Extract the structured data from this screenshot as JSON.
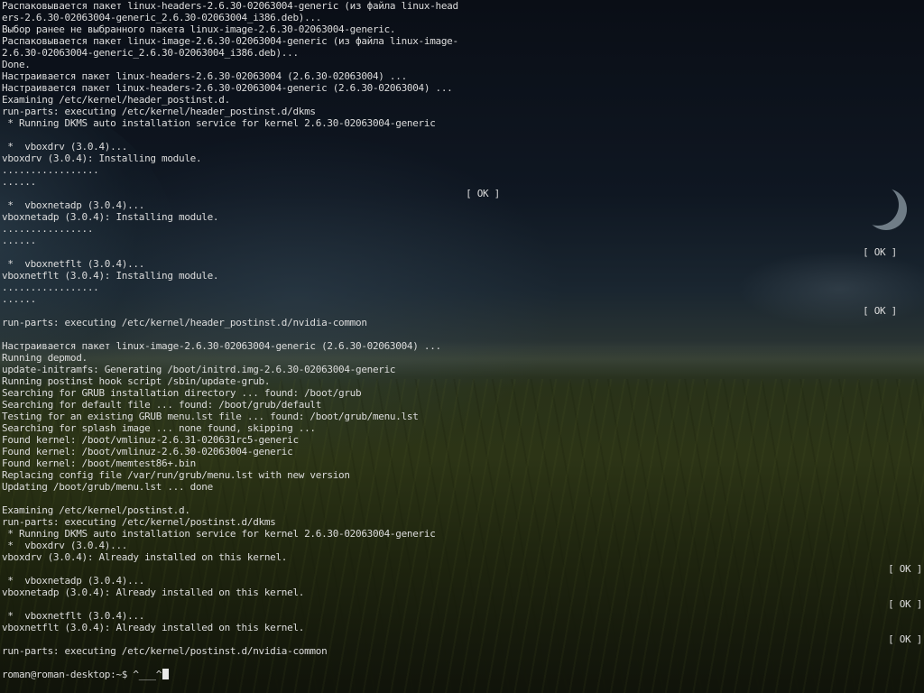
{
  "terminal": {
    "lines": [
      {
        "text": "Распаковывается пакет linux-headers-2.6.30-02063004-generic (из файла linux-head"
      },
      {
        "text": "ers-2.6.30-02063004-generic_2.6.30-02063004_i386.deb)..."
      },
      {
        "text": "Выбор ранее не выбранного пакета linux-image-2.6.30-02063004-generic."
      },
      {
        "text": "Распаковывается пакет linux-image-2.6.30-02063004-generic (из файла linux-image-"
      },
      {
        "text": "2.6.30-02063004-generic_2.6.30-02063004_i386.deb)..."
      },
      {
        "text": "Done."
      },
      {
        "text": "Настраивается пакет linux-headers-2.6.30-02063004 (2.6.30-02063004) ..."
      },
      {
        "text": "Настраивается пакет linux-headers-2.6.30-02063004-generic (2.6.30-02063004) ..."
      },
      {
        "text": "Examining /etc/kernel/header_postinst.d."
      },
      {
        "text": "run-parts: executing /etc/kernel/header_postinst.d/dkms"
      },
      {
        "text": " * Running DKMS auto installation service for kernel 2.6.30-02063004-generic"
      },
      {
        "text": ""
      },
      {
        "text": " *  vboxdrv (3.0.4)..."
      },
      {
        "text": "vboxdrv (3.0.4): Installing module."
      },
      {
        "text": "................."
      },
      {
        "text": "......"
      },
      {
        "text": "",
        "ok": "[ OK ]",
        "ok_pos": "mid"
      },
      {
        "text": " *  vboxnetadp (3.0.4)..."
      },
      {
        "text": "vboxnetadp (3.0.4): Installing module."
      },
      {
        "text": "................"
      },
      {
        "text": "......"
      },
      {
        "text": "",
        "ok": "[ OK ]",
        "ok_pos": "right"
      },
      {
        "text": " *  vboxnetflt (3.0.4)..."
      },
      {
        "text": "vboxnetflt (3.0.4): Installing module."
      },
      {
        "text": "................."
      },
      {
        "text": "......"
      },
      {
        "text": "",
        "ok": "[ OK ]",
        "ok_pos": "right"
      },
      {
        "text": "run-parts: executing /etc/kernel/header_postinst.d/nvidia-common"
      },
      {
        "text": ""
      },
      {
        "text": "Настраивается пакет linux-image-2.6.30-02063004-generic (2.6.30-02063004) ..."
      },
      {
        "text": "Running depmod."
      },
      {
        "text": "update-initramfs: Generating /boot/initrd.img-2.6.30-02063004-generic"
      },
      {
        "text": "Running postinst hook script /sbin/update-grub."
      },
      {
        "text": "Searching for GRUB installation directory ... found: /boot/grub"
      },
      {
        "text": "Searching for default file ... found: /boot/grub/default"
      },
      {
        "text": "Testing for an existing GRUB menu.lst file ... found: /boot/grub/menu.lst"
      },
      {
        "text": "Searching for splash image ... none found, skipping ..."
      },
      {
        "text": "Found kernel: /boot/vmlinuz-2.6.31-020631rc5-generic"
      },
      {
        "text": "Found kernel: /boot/vmlinuz-2.6.30-02063004-generic"
      },
      {
        "text": "Found kernel: /boot/memtest86+.bin"
      },
      {
        "text": "Replacing config file /var/run/grub/menu.lst with new version"
      },
      {
        "text": "Updating /boot/grub/menu.lst ... done"
      },
      {
        "text": ""
      },
      {
        "text": "Examining /etc/kernel/postinst.d."
      },
      {
        "text": "run-parts: executing /etc/kernel/postinst.d/dkms"
      },
      {
        "text": " * Running DKMS auto installation service for kernel 2.6.30-02063004-generic"
      },
      {
        "text": " *  vboxdrv (3.0.4)..."
      },
      {
        "text": "vboxdrv (3.0.4): Already installed on this kernel."
      },
      {
        "text": "",
        "ok": "[ OK ]",
        "ok_pos": "edge"
      },
      {
        "text": " *  vboxnetadp (3.0.4)..."
      },
      {
        "text": "vboxnetadp (3.0.4): Already installed on this kernel."
      },
      {
        "text": "",
        "ok": "[ OK ]",
        "ok_pos": "edge"
      },
      {
        "text": " *  vboxnetflt (3.0.4)..."
      },
      {
        "text": "vboxnetflt (3.0.4): Already installed on this kernel."
      },
      {
        "text": "",
        "ok": "[ OK ]",
        "ok_pos": "edge"
      },
      {
        "text": "run-parts: executing /etc/kernel/postinst.d/nvidia-common"
      },
      {
        "text": ""
      }
    ],
    "prompt": "roman@roman-desktop:~$ ",
    "input": "^___^"
  }
}
